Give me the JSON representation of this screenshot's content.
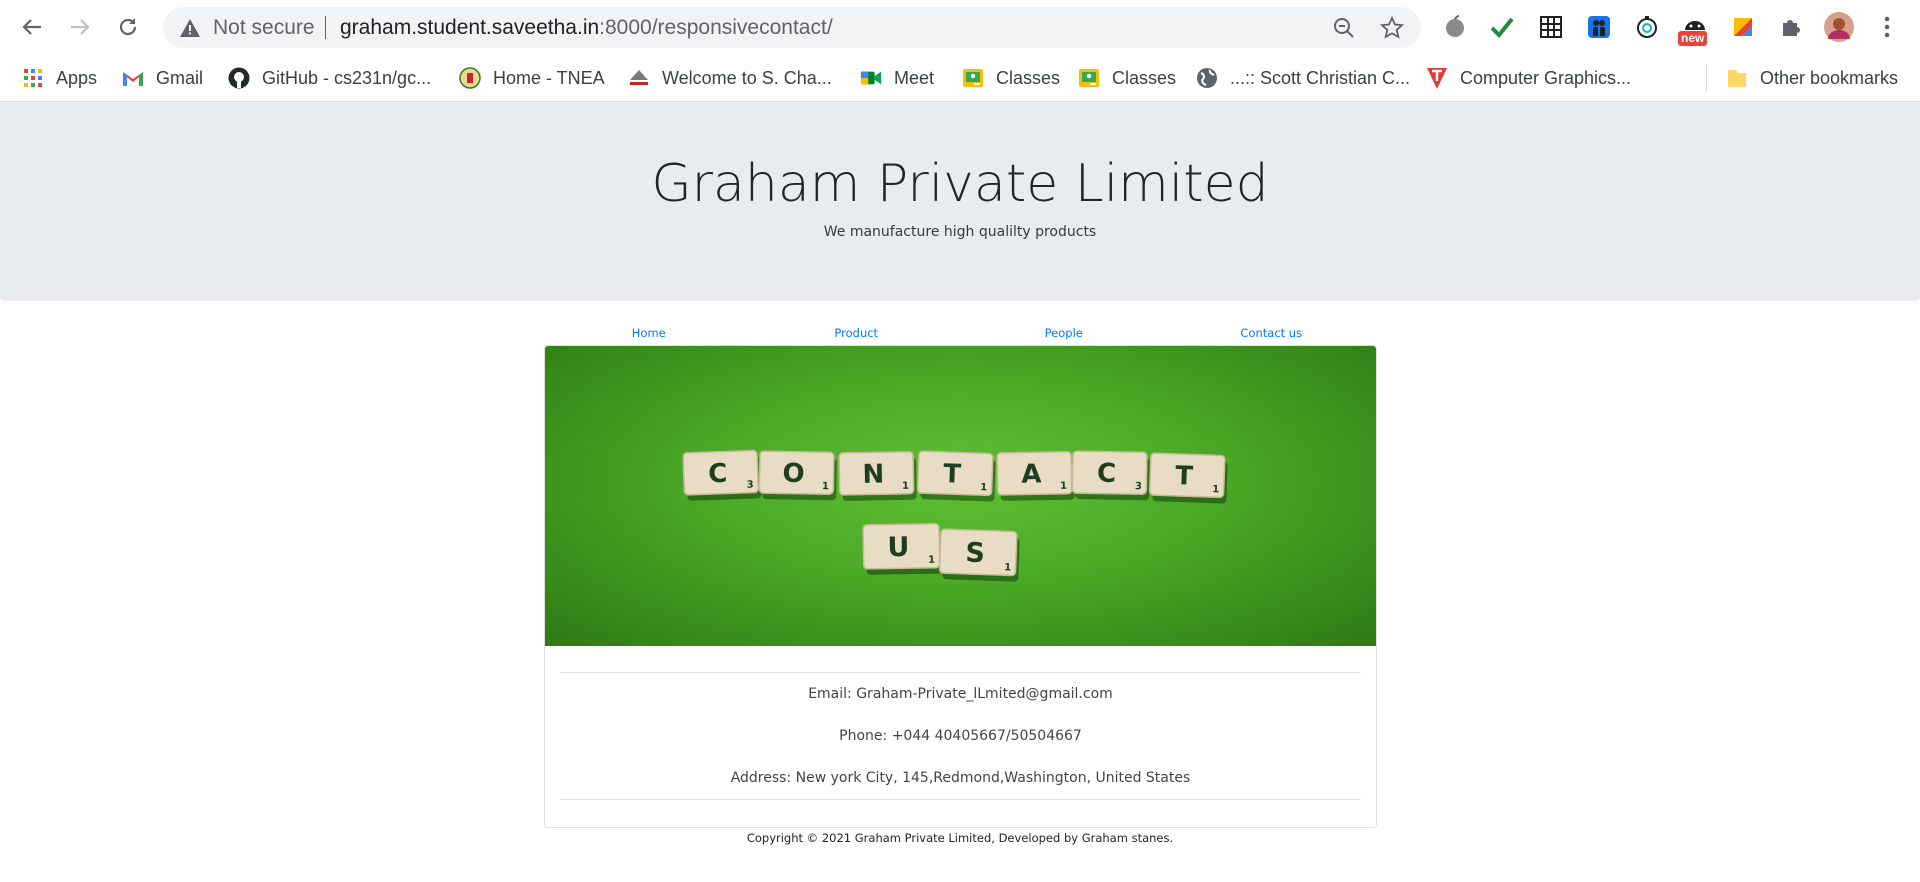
{
  "browser": {
    "security_label": "Not secure",
    "url_host": "graham.student.saveetha.in",
    "url_path": ":8000/responsivecontact/",
    "extension_badge": "new"
  },
  "bookmarks": {
    "items": [
      {
        "label": "Apps",
        "icon": "apps-grid-icon"
      },
      {
        "label": "Gmail",
        "icon": "gmail-icon"
      },
      {
        "label": "GitHub - cs231n/gc...",
        "icon": "github-icon"
      },
      {
        "label": "Home - TNEA",
        "icon": "tnea-emblem-icon"
      },
      {
        "label": "Welcome to S. Cha...",
        "icon": "college-logo-icon"
      },
      {
        "label": "Meet",
        "icon": "meet-icon"
      },
      {
        "label": "Classes",
        "icon": "classroom-icon"
      },
      {
        "label": "Classes",
        "icon": "classroom-icon"
      },
      {
        "label": "...:: Scott Christian C...",
        "icon": "globe-icon"
      },
      {
        "label": "Computer Graphics...",
        "icon": "tutorialspoint-icon"
      }
    ],
    "other_label": "Other bookmarks"
  },
  "header": {
    "title": "Graham Private Limited",
    "subtitle": "We manufacture high qualilty products"
  },
  "nav": {
    "items": [
      "Home",
      "Product",
      "People",
      "Contact us"
    ]
  },
  "hero": {
    "tiles_row1": [
      {
        "letter": "C",
        "score": "3"
      },
      {
        "letter": "O",
        "score": "1"
      },
      {
        "letter": "N",
        "score": "1"
      },
      {
        "letter": "T",
        "score": "1"
      },
      {
        "letter": "A",
        "score": "1"
      },
      {
        "letter": "C",
        "score": "3"
      },
      {
        "letter": "T",
        "score": "1"
      }
    ],
    "tiles_row2": [
      {
        "letter": "U",
        "score": "1"
      },
      {
        "letter": "S",
        "score": "1"
      }
    ]
  },
  "contact": {
    "email": "Email: Graham-Private_lLmited@gmail.com",
    "phone": "Phone: +044 40405667/50504667",
    "address": "Address: New york City, 145,Redmond,Washington, United States"
  },
  "footer": {
    "copyright": "Copyright © 2021 Graham Private Limited, Developed by Graham stanes."
  },
  "colors": {
    "link": "#007bff",
    "jumbotron": "#e9ecef",
    "hero_green": "#4aa826"
  }
}
